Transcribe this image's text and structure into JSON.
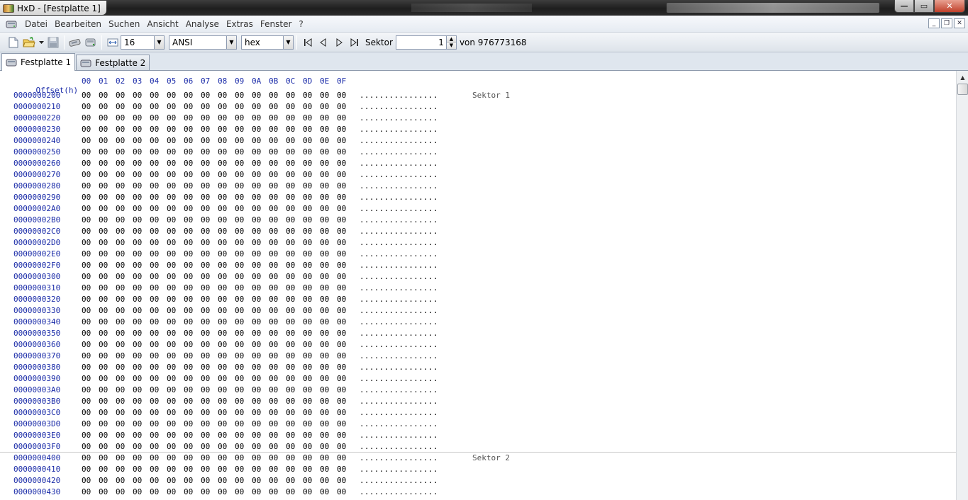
{
  "window": {
    "title": "HxD - [Festplatte 1]",
    "minimize": "—",
    "restore": "▭",
    "close": "✕"
  },
  "menu": {
    "items": [
      "Datei",
      "Bearbeiten",
      "Suchen",
      "Ansicht",
      "Analyse",
      "Extras",
      "Fenster",
      "?"
    ],
    "mdi_minimize": "_",
    "mdi_restore": "❐",
    "mdi_close": "✕"
  },
  "toolbar": {
    "bytes_per_row": "16",
    "charset": "ANSI",
    "offset_base": "hex",
    "sector_label": "Sektor",
    "sector_value": "1",
    "sector_total": "von 976773168"
  },
  "tabs": [
    {
      "label": "Festplatte 1",
      "active": true
    },
    {
      "label": "Festplatte 2",
      "active": false
    }
  ],
  "hex": {
    "offset_header": "Offset(h)",
    "columns": [
      "00",
      "01",
      "02",
      "03",
      "04",
      "05",
      "06",
      "07",
      "08",
      "09",
      "0A",
      "0B",
      "0C",
      "0D",
      "0E",
      "0F"
    ],
    "rows": [
      {
        "offset": "0000000200",
        "sector": "Sektor 1"
      },
      {
        "offset": "0000000210"
      },
      {
        "offset": "0000000220"
      },
      {
        "offset": "0000000230"
      },
      {
        "offset": "0000000240"
      },
      {
        "offset": "0000000250"
      },
      {
        "offset": "0000000260"
      },
      {
        "offset": "0000000270"
      },
      {
        "offset": "0000000280"
      },
      {
        "offset": "0000000290"
      },
      {
        "offset": "00000002A0"
      },
      {
        "offset": "00000002B0"
      },
      {
        "offset": "00000002C0"
      },
      {
        "offset": "00000002D0"
      },
      {
        "offset": "00000002E0"
      },
      {
        "offset": "00000002F0"
      },
      {
        "offset": "0000000300"
      },
      {
        "offset": "0000000310"
      },
      {
        "offset": "0000000320"
      },
      {
        "offset": "0000000330"
      },
      {
        "offset": "0000000340"
      },
      {
        "offset": "0000000350"
      },
      {
        "offset": "0000000360"
      },
      {
        "offset": "0000000370"
      },
      {
        "offset": "0000000380"
      },
      {
        "offset": "0000000390"
      },
      {
        "offset": "00000003A0"
      },
      {
        "offset": "00000003B0"
      },
      {
        "offset": "00000003C0"
      },
      {
        "offset": "00000003D0"
      },
      {
        "offset": "00000003E0"
      },
      {
        "offset": "00000003F0"
      },
      {
        "offset": "0000000400",
        "sector": "Sektor 2"
      },
      {
        "offset": "0000000410"
      },
      {
        "offset": "0000000420"
      },
      {
        "offset": "0000000430"
      }
    ],
    "byte_value": "00",
    "ascii_text": "................"
  }
}
